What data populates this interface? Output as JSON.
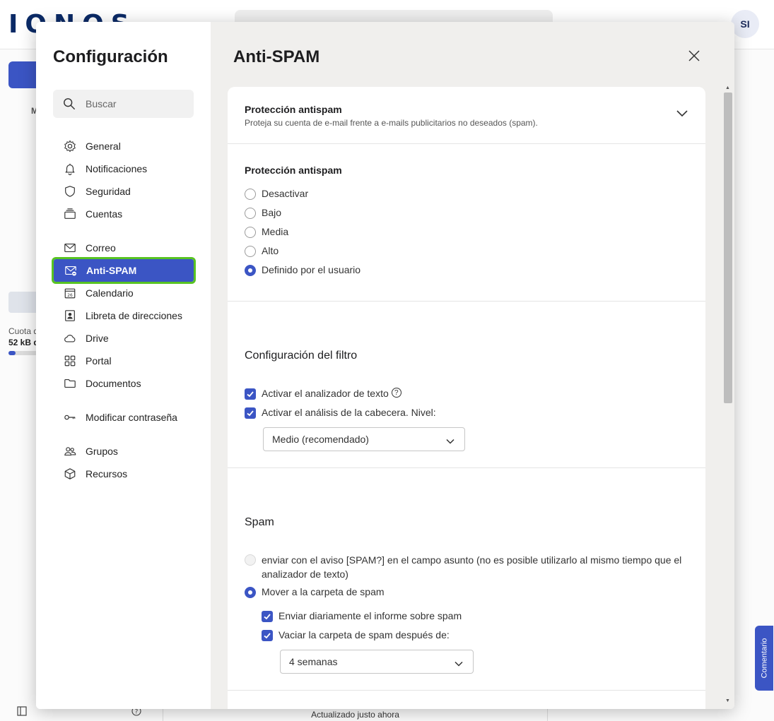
{
  "background": {
    "logo": "IONOS",
    "avatar": "SI",
    "sidebar_quota_label": "Cuota d",
    "sidebar_quota_value": "52 kB d",
    "sidebar_folder_label": "M",
    "status_text": "Actualizado justo ahora",
    "feedback_label": "Comentario"
  },
  "settings": {
    "title": "Configuración",
    "search_placeholder": "Buscar",
    "nav": [
      {
        "label": "General",
        "icon": "gear-icon"
      },
      {
        "label": "Notificaciones",
        "icon": "bell-icon"
      },
      {
        "label": "Seguridad",
        "icon": "shield-icon"
      },
      {
        "label": "Cuentas",
        "icon": "accounts-icon"
      },
      {
        "label": "Correo",
        "icon": "mail-icon"
      },
      {
        "label": "Anti-SPAM",
        "icon": "mail-block-icon"
      },
      {
        "label": "Calendario",
        "icon": "calendar-icon"
      },
      {
        "label": "Libreta de direcciones",
        "icon": "contacts-icon"
      },
      {
        "label": "Drive",
        "icon": "cloud-icon"
      },
      {
        "label": "Portal",
        "icon": "grid-icon"
      },
      {
        "label": "Documentos",
        "icon": "folder-icon"
      },
      {
        "label": "Modificar contraseña",
        "icon": "key-icon"
      },
      {
        "label": "Grupos",
        "icon": "groups-icon"
      },
      {
        "label": "Recursos",
        "icon": "cube-icon"
      }
    ],
    "active_nav": "Anti-SPAM"
  },
  "page": {
    "title": "Anti-SPAM",
    "card_header": {
      "title": "Protección antispam",
      "subtitle": "Proteja su cuenta de e-mail frente a e-mails publicitarios no deseados (spam)."
    },
    "protection": {
      "title": "Protección antispam",
      "options": [
        "Desactivar",
        "Bajo",
        "Media",
        "Alto",
        "Definido por el usuario"
      ],
      "selected": "Definido por el usuario"
    },
    "filter": {
      "title": "Configuración del filtro",
      "text_analyzer": "Activar el analizador de texto",
      "header_analysis": "Activar el análisis de la cabecera. Nivel:",
      "level_value": "Medio (recomendado)"
    },
    "spam": {
      "title": "Spam",
      "option_tag": "enviar con el aviso [SPAM?] en el campo asunto (no es posible utilizarlo al mismo tiempo que el analizador de texto)",
      "option_move": "Mover a la carpeta de spam",
      "daily_report": "Enviar diariamente el informe sobre spam",
      "empty_after": "Vaciar la carpeta de spam después de:",
      "empty_after_value": "4 semanas"
    }
  },
  "colors": {
    "accent": "#3b55c4",
    "active_outline": "#58c322"
  }
}
